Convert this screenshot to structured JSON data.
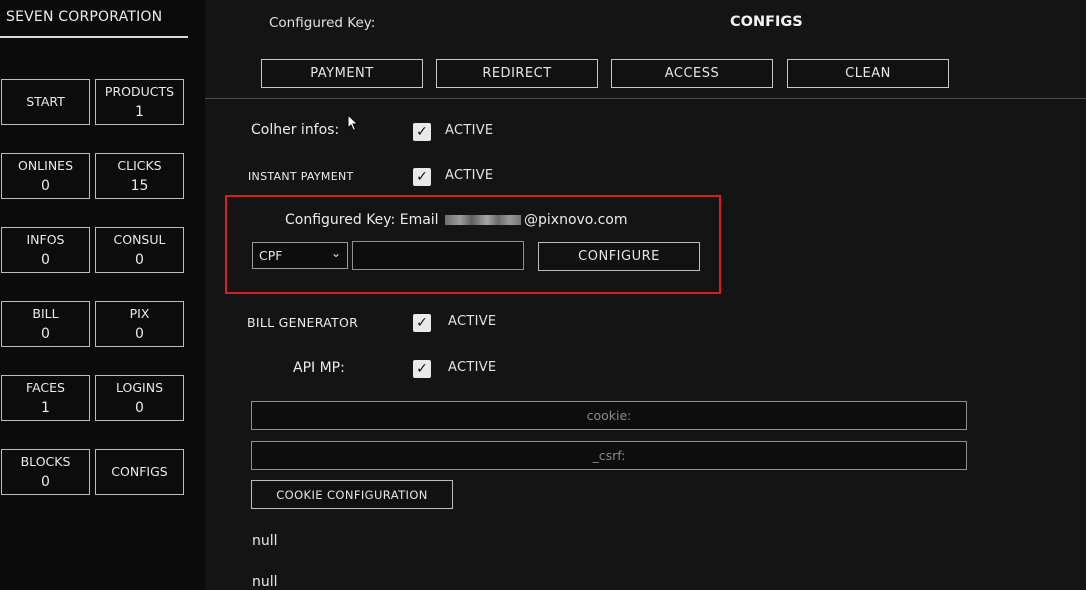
{
  "sidebar": {
    "brand": "SEVEN CORPORATION",
    "tiles": [
      {
        "label": "START",
        "count": ""
      },
      {
        "label": "PRODUCTS",
        "count": "1"
      },
      {
        "label": "ONLINES",
        "count": "0"
      },
      {
        "label": "CLICKS",
        "count": "15"
      },
      {
        "label": "INFOS",
        "count": "0"
      },
      {
        "label": "CONSUL",
        "count": "0"
      },
      {
        "label": "BILL",
        "count": "0"
      },
      {
        "label": "PIX",
        "count": "0"
      },
      {
        "label": "FACES",
        "count": "1"
      },
      {
        "label": "LOGINS",
        "count": "0"
      },
      {
        "label": "BLOCKS",
        "count": "0"
      },
      {
        "label": "CONFIGS",
        "count": ""
      }
    ]
  },
  "header": {
    "configured_key_label": "Configured Key:",
    "title": "CONFIGS",
    "tabs": [
      "PAYMENT",
      "REDIRECT",
      "ACCESS",
      "CLEAN"
    ]
  },
  "settings": {
    "colher_infos": {
      "label": "Colher infos:",
      "checked": true,
      "status": "ACTIVE"
    },
    "instant_payment": {
      "label": "INSTANT PAYMENT",
      "checked": true,
      "status": "ACTIVE"
    },
    "bill_generator": {
      "label": "BILL GENERATOR",
      "checked": true,
      "status": "ACTIVE"
    },
    "api_mp": {
      "label": "API MP:",
      "checked": true,
      "status": "ACTIVE"
    }
  },
  "key_config": {
    "prefix": "Configured Key: Email",
    "suffix": "@pixnovo.com",
    "select_value": "CPF",
    "key_input_value": "",
    "configure_label": "CONFIGURE"
  },
  "cookies": {
    "cookie_placeholder": "cookie:",
    "csrf_placeholder": "_csrf:",
    "button_label": "COOKIE CONFIGURATION"
  },
  "results": [
    "null",
    "null"
  ],
  "check_mark": "✓",
  "select_arrow": "⌄"
}
